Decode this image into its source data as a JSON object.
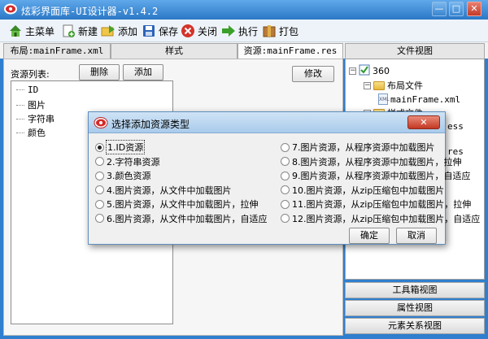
{
  "window": {
    "title": "炫彩界面库-UI设计器-v1.4.2",
    "minimize": "—",
    "maximize": "□",
    "close": "✕"
  },
  "toolbar": {
    "main_menu": "主菜单",
    "new": "新建",
    "add": "添加",
    "save": "保存",
    "close": "关闭",
    "run": "执行",
    "pack": "打包"
  },
  "tabs": {
    "layout": "布局:mainFrame.xml",
    "style": "样式",
    "resource": "资源:mainFrame.res",
    "file_view": "文件视图"
  },
  "resource_panel": {
    "list_label": "资源列表:",
    "delete_btn": "删除",
    "add_btn": "添加",
    "modify_btn": "修改",
    "items": [
      "ID",
      "图片",
      "字符串",
      "颜色"
    ]
  },
  "file_tree": {
    "root": "360",
    "layout_folder": "布局文件",
    "layout_file": "mainFrame.xml",
    "style_folder": "样式文件",
    "expand_minus": "−",
    "xml_badge": "XML",
    "clip_css": "ess",
    "clip_res": "res"
  },
  "side_buttons": {
    "toolbox": "工具箱视图",
    "properties": "属性视图",
    "relations": "元素关系视图"
  },
  "dialog": {
    "title": "选择添加资源类型",
    "close": "✕",
    "selected_index": 0,
    "left_options": [
      "1.ID资源",
      "2.字符串资源",
      "3.颜色资源",
      "4.图片资源，从文件中加载图片",
      "5.图片资源，从文件中加载图片，拉伸",
      "6.图片资源，从文件中加载图片，自适应"
    ],
    "right_options": [
      "7.图片资源，从程序资源中加载图片",
      "8.图片资源，从程序资源中加载图片，拉伸",
      "9.图片资源，从程序资源中加载图片，自适应",
      "10.图片资源，从zip压缩包中加载图片",
      "11.图片资源，从zip压缩包中加载图片，拉伸",
      "12.图片资源，从zip压缩包中加载图片，自适应"
    ],
    "ok": "确定",
    "cancel": "取消"
  }
}
